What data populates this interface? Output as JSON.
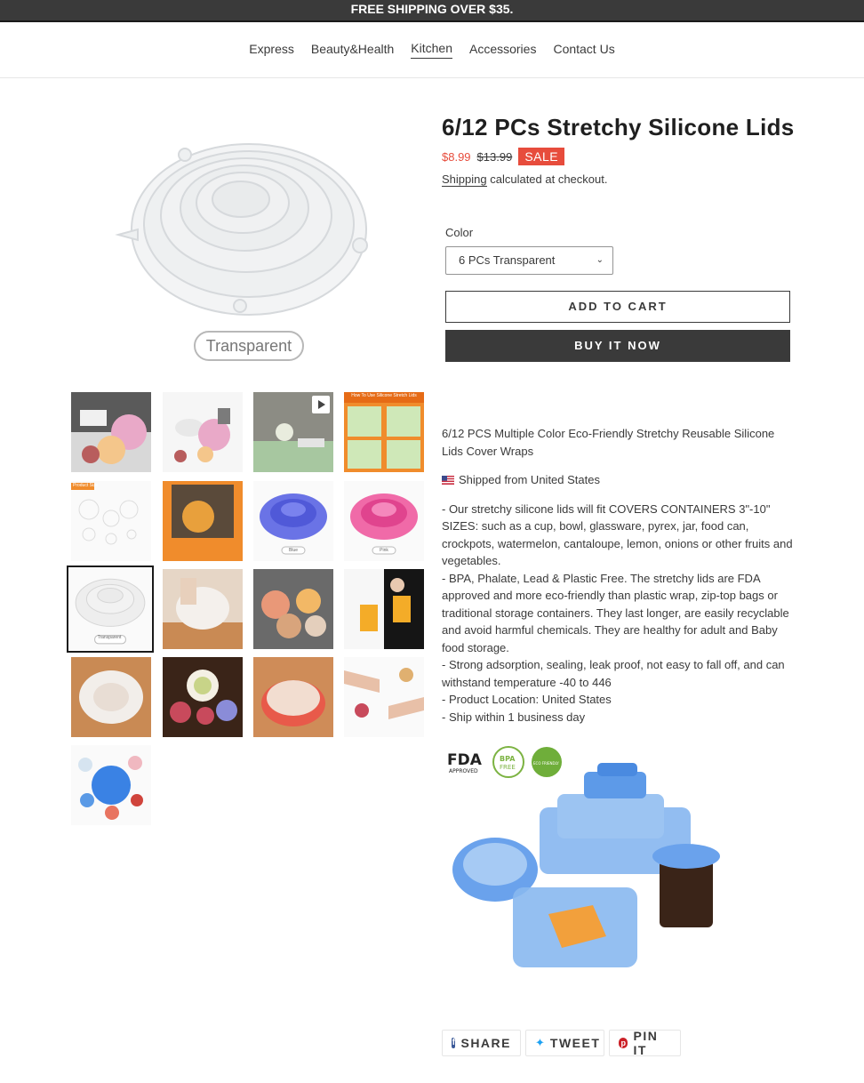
{
  "announcement": "FREE SHIPPING OVER $35.",
  "nav": {
    "items": [
      "Express",
      "Beauty&Health",
      "Kitchen",
      "Accessories",
      "Contact Us"
    ],
    "active": "Kitchen"
  },
  "main_image": {
    "caption": "Transparent"
  },
  "thumbnails": [
    {
      "label": ""
    },
    {
      "label": ""
    },
    {
      "label": ""
    },
    {
      "label": "How To Use Silicone Stretch Lids"
    },
    {
      "label": "Product Size"
    },
    {
      "label": ""
    },
    {
      "label": "Blue"
    },
    {
      "label": "Pink"
    },
    {
      "label": "Transparent"
    },
    {
      "label": ""
    },
    {
      "label": ""
    },
    {
      "label": ""
    },
    {
      "label": ""
    },
    {
      "label": ""
    },
    {
      "label": ""
    },
    {
      "label": ""
    },
    {
      "label": ""
    }
  ],
  "product": {
    "title": "6/12 PCs Stretchy Silicone Lids",
    "price": "$8.99",
    "compare_price": "$13.99",
    "badge": "SALE",
    "shipping_link": "Shipping",
    "shipping_rest": " calculated at checkout.",
    "color_label": "Color",
    "color_selected": "6 PCs Transparent",
    "add_to_cart": "ADD TO CART",
    "buy_now": "BUY IT NOW"
  },
  "description": {
    "intro": "6/12 PCS Multiple Color Eco-Friendly Stretchy Reusable Silicone Lids Cover Wraps",
    "shipped": "Shipped from United States",
    "bullets": [
      "- Our stretchy silicone lids will fit COVERS CONTAINERS 3\"-10\" SIZES: such as a cup, bowl, glassware, pyrex, jar, food can, crockpots, watermelon, cantaloupe, lemon, onions or other fruits and vegetables.",
      "- BPA, Phalate, Lead & Plastic Free. The stretchy lids are FDA approved and more eco-friendly than plastic wrap, zip-top bags or traditional storage containers. They last longer, are easily recyclable and avoid harmful chemicals. They are healthy for adult and Baby food storage.",
      "- Strong adsorption, sealing, leak proof, not easy to fall off, and can withstand temperature -40 to 446",
      "- Product Location: United States",
      "- Ship within 1 business day"
    ]
  },
  "promo_badges": {
    "fda": "FDA",
    "fda_sub": "APPROVED",
    "bpa": "BPA",
    "bpa_sub": "FREE",
    "eco": "ECO FRIENDLY"
  },
  "share": {
    "facebook": "SHARE",
    "twitter": "TWEET",
    "pinterest": "PIN IT"
  },
  "colors": {
    "accent_red": "#e74c3c",
    "dark": "#3a3a3a",
    "lid_blue": "#4a90e2",
    "lid_pink": "#e0448e"
  }
}
